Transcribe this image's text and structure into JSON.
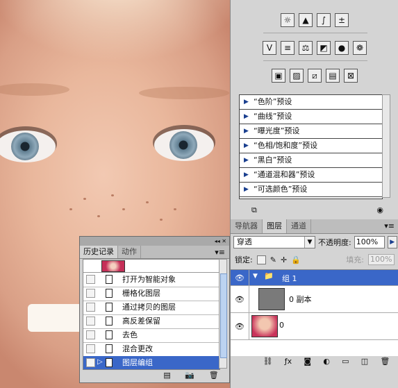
{
  "adjustments": {
    "icon_rows": [
      [
        "brightness-icon",
        "levels-icon",
        "curves-icon",
        "exposure-icon"
      ],
      [
        "vibrance-icon",
        "hue-saturation-icon",
        "color-balance-icon",
        "black-white-icon",
        "photo-filter-icon",
        "channel-mixer-icon"
      ],
      [
        "invert-icon",
        "posterize-icon",
        "threshold-icon",
        "gradient-map-icon",
        "selective-color-icon"
      ]
    ],
    "presets": [
      "“色阶”预设",
      "“曲线”预设",
      "“曝光度”预设",
      "“色相/饱和度”预设",
      "“黑白”预设",
      "“通道混和器”预设",
      "“可选颜色”预设"
    ]
  },
  "layers_panel": {
    "tabs": [
      "导航器",
      "图层",
      "通道"
    ],
    "active_tab": "图层",
    "blend_mode": "穿透",
    "opacity_label": "不透明度:",
    "opacity_value": "100%",
    "lock_label": "锁定:",
    "fill_label": "填充:",
    "fill_value": "100%",
    "layers": [
      {
        "name": "组 1",
        "type": "group"
      },
      {
        "name": "0 副本",
        "type": "layer"
      },
      {
        "name": "0",
        "type": "layer"
      }
    ],
    "footer_icons": [
      "link-icon",
      "fx-icon",
      "mask-icon",
      "adjustment-icon",
      "folder-icon",
      "new-layer-icon",
      "trash-icon"
    ]
  },
  "history_panel": {
    "tabs": [
      "历史记录",
      "动作"
    ],
    "active_tab": "历史记录",
    "items": [
      "打开为智能对象",
      "栅格化图层",
      "通过拷贝的图层",
      "高反差保留",
      "去色",
      "混合更改",
      "图层编组"
    ],
    "active_item": "图层编组"
  },
  "colors": {
    "panel_bg": "#d4d4d4",
    "selection": "#3a67c8",
    "preset_arrow": "#1a3f8f"
  }
}
